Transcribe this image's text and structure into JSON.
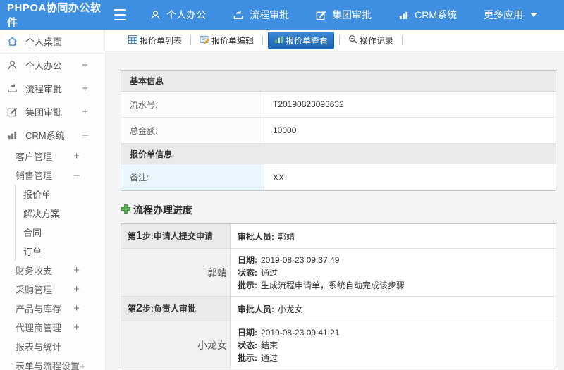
{
  "topbar": {
    "logo": "PHPOA协同办公软件",
    "nav": [
      {
        "label": "个人办公",
        "icon": "user-icon"
      },
      {
        "label": "流程审批",
        "icon": "workflow-icon"
      },
      {
        "label": "集团审批",
        "icon": "compose-icon"
      },
      {
        "label": "CRM系统",
        "icon": "bar-chart-icon"
      },
      {
        "label": "更多应用",
        "icon": "caret-down-icon"
      }
    ]
  },
  "sidebar": {
    "items": [
      {
        "label": "个人桌面",
        "icon": "home-icon",
        "toggle": ""
      },
      {
        "label": "个人办公",
        "icon": "user-icon",
        "toggle": "+"
      },
      {
        "label": "流程审批",
        "icon": "workflow-icon",
        "toggle": "+"
      },
      {
        "label": "集团审批",
        "icon": "compose-icon",
        "toggle": "+"
      },
      {
        "label": "CRM系统",
        "icon": "bar-chart-icon",
        "toggle": "–"
      },
      {
        "label": "客户管理",
        "toggle": "+"
      },
      {
        "label": "销售管理",
        "toggle": "–"
      },
      {
        "label": "报价单",
        "toggle": ""
      },
      {
        "label": "解决方案",
        "toggle": ""
      },
      {
        "label": "合同",
        "toggle": ""
      },
      {
        "label": "订单",
        "toggle": ""
      },
      {
        "label": "财务收支",
        "toggle": "+"
      },
      {
        "label": "采购管理",
        "toggle": "+"
      },
      {
        "label": "产品与库存",
        "toggle": "+"
      },
      {
        "label": "代理商管理",
        "toggle": "+"
      },
      {
        "label": "报表与统计",
        "toggle": ""
      },
      {
        "label": "表单与流程设置+",
        "toggle": ""
      }
    ]
  },
  "tabbar": {
    "tabs": [
      {
        "label": "报价单列表",
        "icon": "table-icon",
        "active": false
      },
      {
        "label": "报价单编辑",
        "icon": "edit-note-icon",
        "active": false
      },
      {
        "label": "报价单查看",
        "icon": "view-chart-icon",
        "active": true
      },
      {
        "label": "操作记录",
        "icon": "magnifier-icon",
        "active": false
      }
    ]
  },
  "basic_info": {
    "header": "基本信息",
    "rows": [
      {
        "label": "流水号:",
        "value": "T20190823093632"
      },
      {
        "label": "总金额:",
        "value": "10000"
      }
    ]
  },
  "quote_info": {
    "header": "报价单信息",
    "rows": [
      {
        "label": "备注:",
        "value": "XX"
      }
    ]
  },
  "process": {
    "title": "流程办理进度",
    "steps": [
      {
        "step_prefix": "第",
        "step_num": "1",
        "step_rest": "步:申请人提交申请",
        "approver_label": "审批人员:",
        "approver": "郭靖",
        "name": "郭靖",
        "date_label": "日期:",
        "date": "2019-08-23 09:37:49",
        "status_label": "状态:",
        "status": "通过",
        "comment_label": "批示:",
        "comment": "生成流程申请单，系统自动完成该步骤"
      },
      {
        "step_prefix": "第",
        "step_num": "2",
        "step_rest": "步:负责人审批",
        "approver_label": "审批人员:",
        "approver": "小龙女",
        "name": "小龙女",
        "date_label": "日期:",
        "date": "2019-08-23 09:41:21",
        "status_label": "状态:",
        "status": "结束",
        "comment_label": "批示:",
        "comment": "通过"
      }
    ]
  },
  "colors": {
    "topbar_blue": "#3e8ee2",
    "active_tab_top": "#3b8ad8",
    "active_tab_bottom": "#1d63b2",
    "home_icon_blue": "#4a90e2",
    "plus_green": "#55b54a",
    "note_cell_blue": "#eaf5fc"
  }
}
